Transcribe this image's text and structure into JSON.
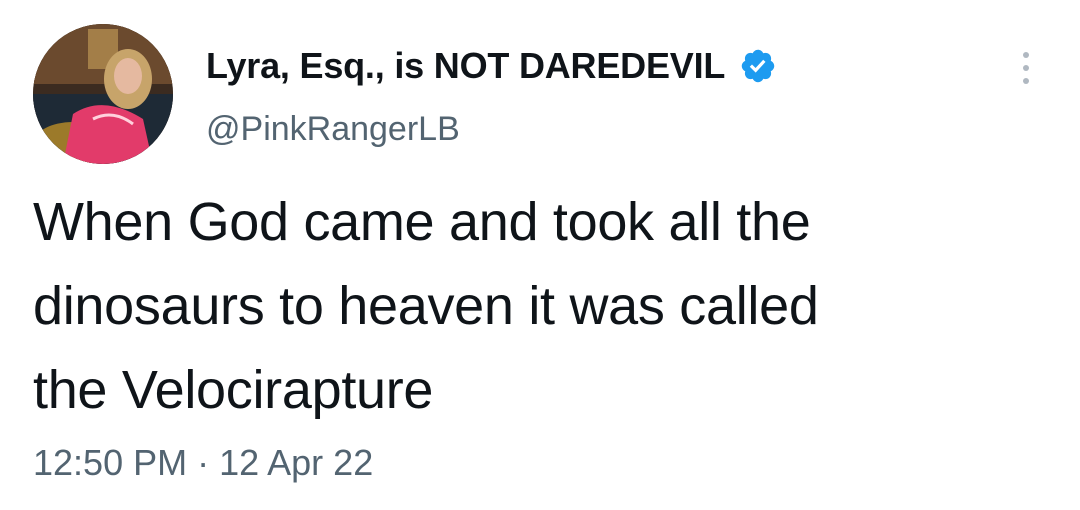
{
  "author": {
    "display_name": "Lyra, Esq., is NOT DAREDEVIL",
    "handle": "@PinkRangerLB",
    "verified_icon": "verified-badge-icon",
    "avatar_icon": "profile-photo"
  },
  "tweet": {
    "text_lines": [
      "When God came and took all the",
      "dinosaurs to heaven it was called",
      "the Velocirapture"
    ],
    "time": "12:50 PM",
    "separator": " · ",
    "date": "12 Apr 22"
  },
  "menu": {
    "icon": "more-options-icon"
  },
  "colors": {
    "text": "#0f1419",
    "secondary": "#536471",
    "verified": "#1d9bf0",
    "background": "#ffffff"
  }
}
